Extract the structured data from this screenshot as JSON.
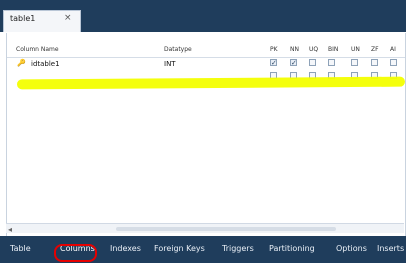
{
  "window": {
    "tab_title": "table1",
    "close_glyph": "×"
  },
  "grid": {
    "columns": [
      "Column Name",
      "Datatype",
      "PK",
      "NN",
      "UQ",
      "BIN",
      "UN",
      "ZF",
      "AI"
    ],
    "rows": [
      {
        "icon": "key-icon",
        "name": "idtable1",
        "datatype": "INT",
        "flags": [
          true,
          true,
          false,
          false,
          false,
          false,
          false
        ]
      }
    ]
  },
  "bottom_tabs": [
    "Table",
    "Columns",
    "Indexes",
    "Foreign Keys",
    "Triggers",
    "Partitioning",
    "Options",
    "Inserts"
  ],
  "active_bottom_tab": "Columns",
  "colors": {
    "highlight": "#f3ff00",
    "annotation": "#e60000",
    "toolbar": "#1f3d5c"
  }
}
